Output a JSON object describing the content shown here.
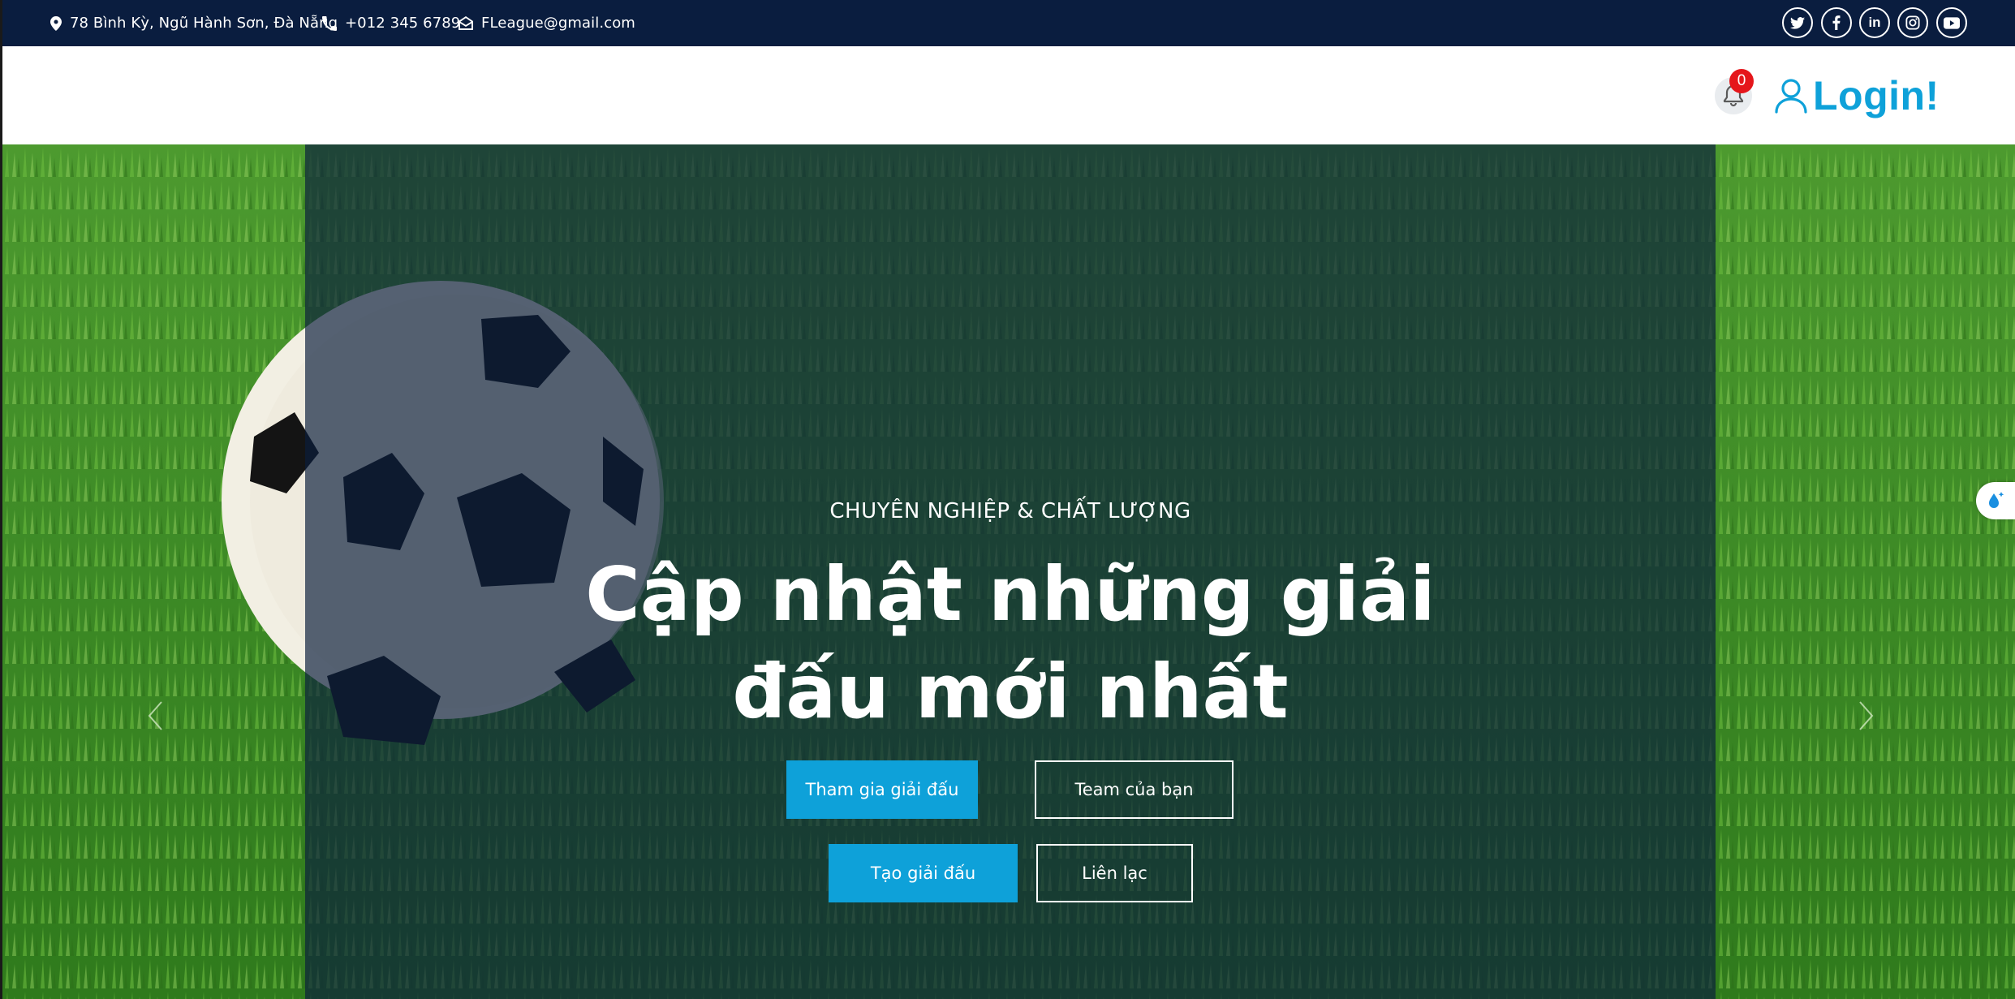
{
  "topbar": {
    "address": "78 Bình Kỳ, Ngũ Hành Sơn, Đà Nẵng",
    "phone": "+012 345 6789",
    "email": "FLeague@gmail.com",
    "social": [
      "twitter-icon",
      "facebook-icon",
      "linkedin-icon",
      "instagram-icon",
      "youtube-icon"
    ]
  },
  "navbar": {
    "notification_count": "0",
    "login_label": "Login!"
  },
  "hero": {
    "kicker": "CHUYÊN NGHIỆP & CHẤT LƯỢNG",
    "headline_line1": "Cập nhật những giải",
    "headline_line2": "đấu mới nhất",
    "buttons": {
      "join": "Tham gia giải đấu",
      "team": "Team của bạn",
      "create": "Tạo giải đấu",
      "contact": "Liên lạc"
    }
  },
  "colors": {
    "topbar_bg": "#0a1d3f",
    "accent": "#0ea1d9",
    "badge": "#e5161b"
  }
}
